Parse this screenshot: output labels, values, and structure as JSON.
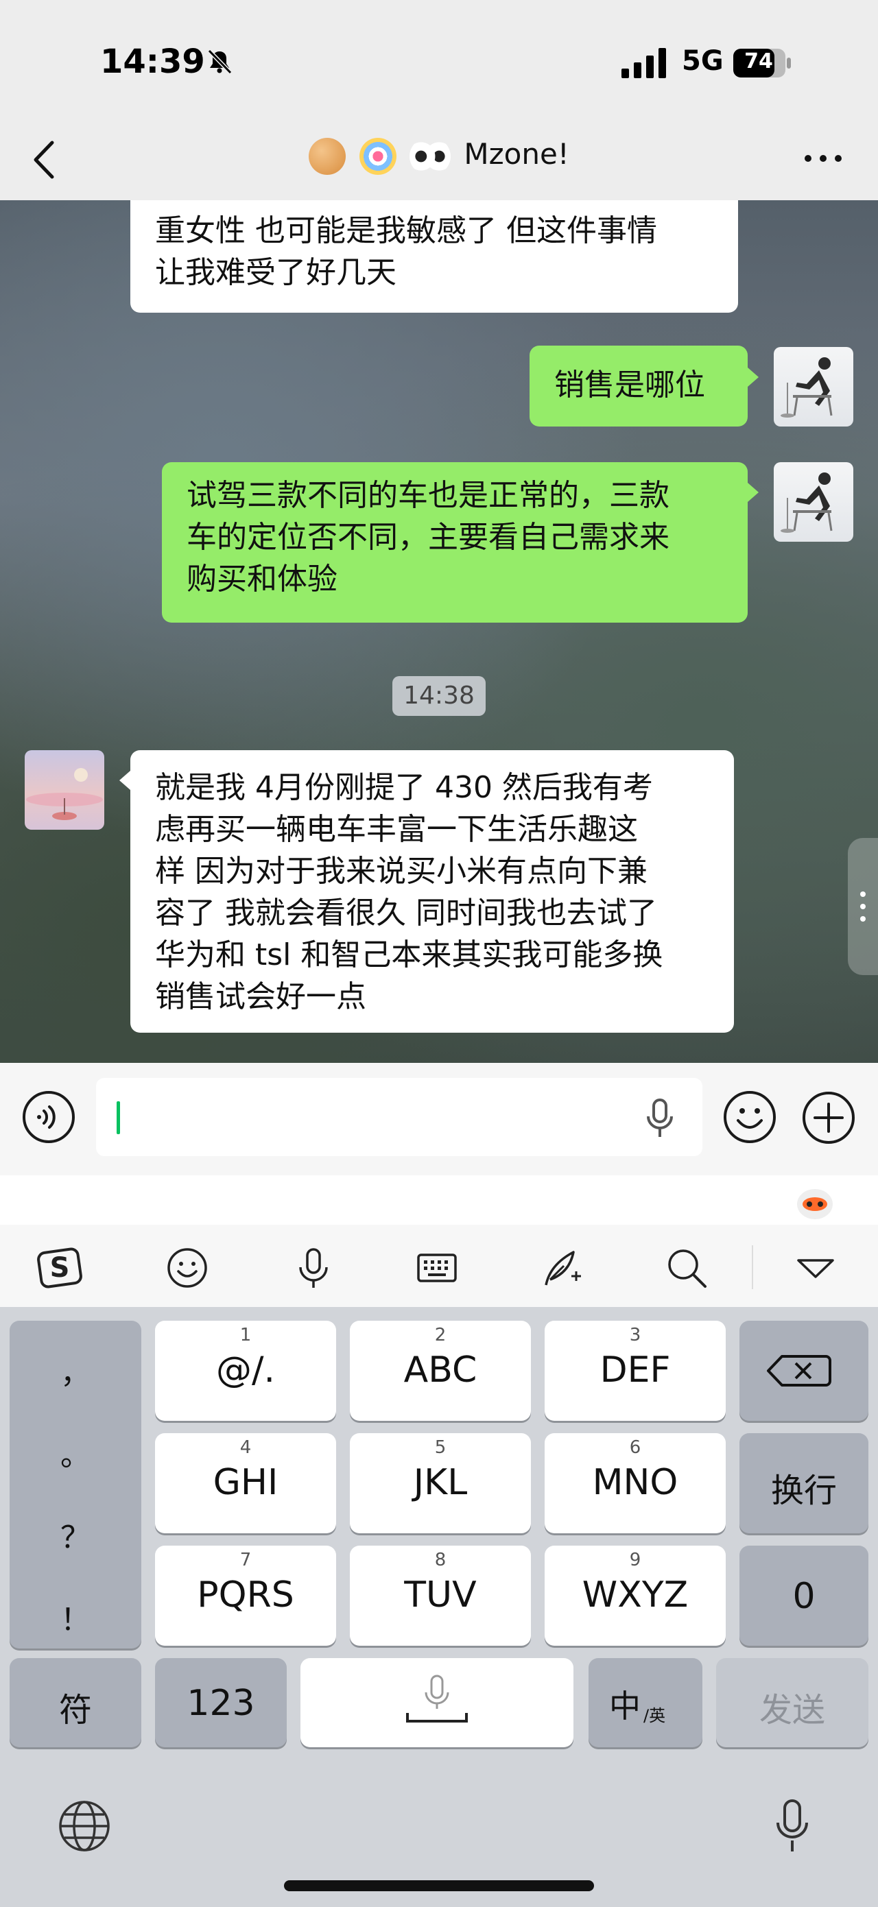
{
  "status_bar": {
    "time": "14:39",
    "network": "5G",
    "battery": "74"
  },
  "nav": {
    "title": "Mzone!"
  },
  "messages": [
    {
      "from": "peer",
      "text": "重女性 也可能是我敏感了 但这件事情\n让我难受了好几天"
    },
    {
      "from": "me",
      "text": "销售是哪位"
    },
    {
      "from": "me",
      "text": "试驾三款不同的车也是正常的，三款\n车的定位否不同，主要看自己需求来\n购买和体验"
    },
    {
      "from": "peer",
      "text": "就是我 4月份刚提了 430 然后我有考\n虑再买一辆电车丰富一下生活乐趣这\n样  因为对于我来说买小米有点向下兼\n容了 我就会看很久 同时间我也去试了\n华为和 tsl 和智己本来其实我可能多换\n销售试会好一点"
    }
  ],
  "timestamp_chip": "14:38",
  "keyboard": {
    "punctuation": [
      "，",
      "。",
      "？",
      "！"
    ],
    "keys": [
      {
        "num": "1",
        "label": "@/."
      },
      {
        "num": "2",
        "label": "ABC"
      },
      {
        "num": "3",
        "label": "DEF"
      },
      {
        "num": "4",
        "label": "GHI"
      },
      {
        "num": "5",
        "label": "JKL"
      },
      {
        "num": "6",
        "label": "MNO"
      },
      {
        "num": "7",
        "label": "PQRS"
      },
      {
        "num": "8",
        "label": "TUV"
      },
      {
        "num": "9",
        "label": "WXYZ"
      }
    ],
    "newline": "换行",
    "zero": "0",
    "symbols": "符",
    "numbers": "123",
    "lang_main": "中",
    "lang_sub": "/英",
    "send": "发送"
  },
  "ime_toolbar_icons": [
    "sogou-logo-icon",
    "emoji-icon",
    "voice-icon",
    "keyboard-icon",
    "handwriting-icon",
    "search-icon",
    "collapse-icon"
  ],
  "colors": {
    "my_bubble": "#95ec69",
    "peer_bubble": "#ffffff",
    "caret": "#07c160"
  }
}
